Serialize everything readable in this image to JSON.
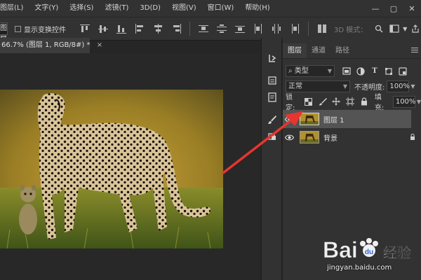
{
  "menu": [
    "图层(L)",
    "文字(Y)",
    "选择(S)",
    "滤镜(T)",
    "3D(D)",
    "视图(V)",
    "窗口(W)",
    "帮助(H)"
  ],
  "options": {
    "select_value": "图层",
    "show_transform": "显示变换控件",
    "mode_3d": "3D 模式："
  },
  "document_tab": {
    "title": "66.7% (图层 1, RGB/8#) *",
    "close": "×"
  },
  "layers_panel": {
    "tabs": [
      "图层",
      "通道",
      "路径"
    ],
    "filter_kind": "类型",
    "blend_mode": "正常",
    "opacity_label": "不透明度:",
    "opacity_value": "100%",
    "lock_label": "锁定:",
    "fill_label": "填充:",
    "fill_value": "100%",
    "layers": [
      {
        "name": "图层 1",
        "selected": true,
        "visible": true,
        "locked": false
      },
      {
        "name": "背景",
        "selected": false,
        "visible": true,
        "locked": true
      }
    ]
  },
  "watermark": {
    "brand_a": "Bai",
    "brand_b": "经验",
    "url": "jingyan.baidu.com"
  },
  "colors": {
    "panel_bg": "#323232",
    "canvas_bg": "#282828",
    "selected_layer": "#545454",
    "annotation_arrow": "#e8352f"
  },
  "icons": [
    "minimize-icon",
    "restore-icon",
    "close-icon",
    "search-icon",
    "workspace-icon",
    "share-icon",
    "history-icon",
    "brush-icon",
    "eye-icon",
    "lock-icon",
    "filter-pixel-icon",
    "filter-adjust-icon",
    "filter-text-icon",
    "filter-shape-icon",
    "filter-smart-icon",
    "panel-menu-icon"
  ]
}
